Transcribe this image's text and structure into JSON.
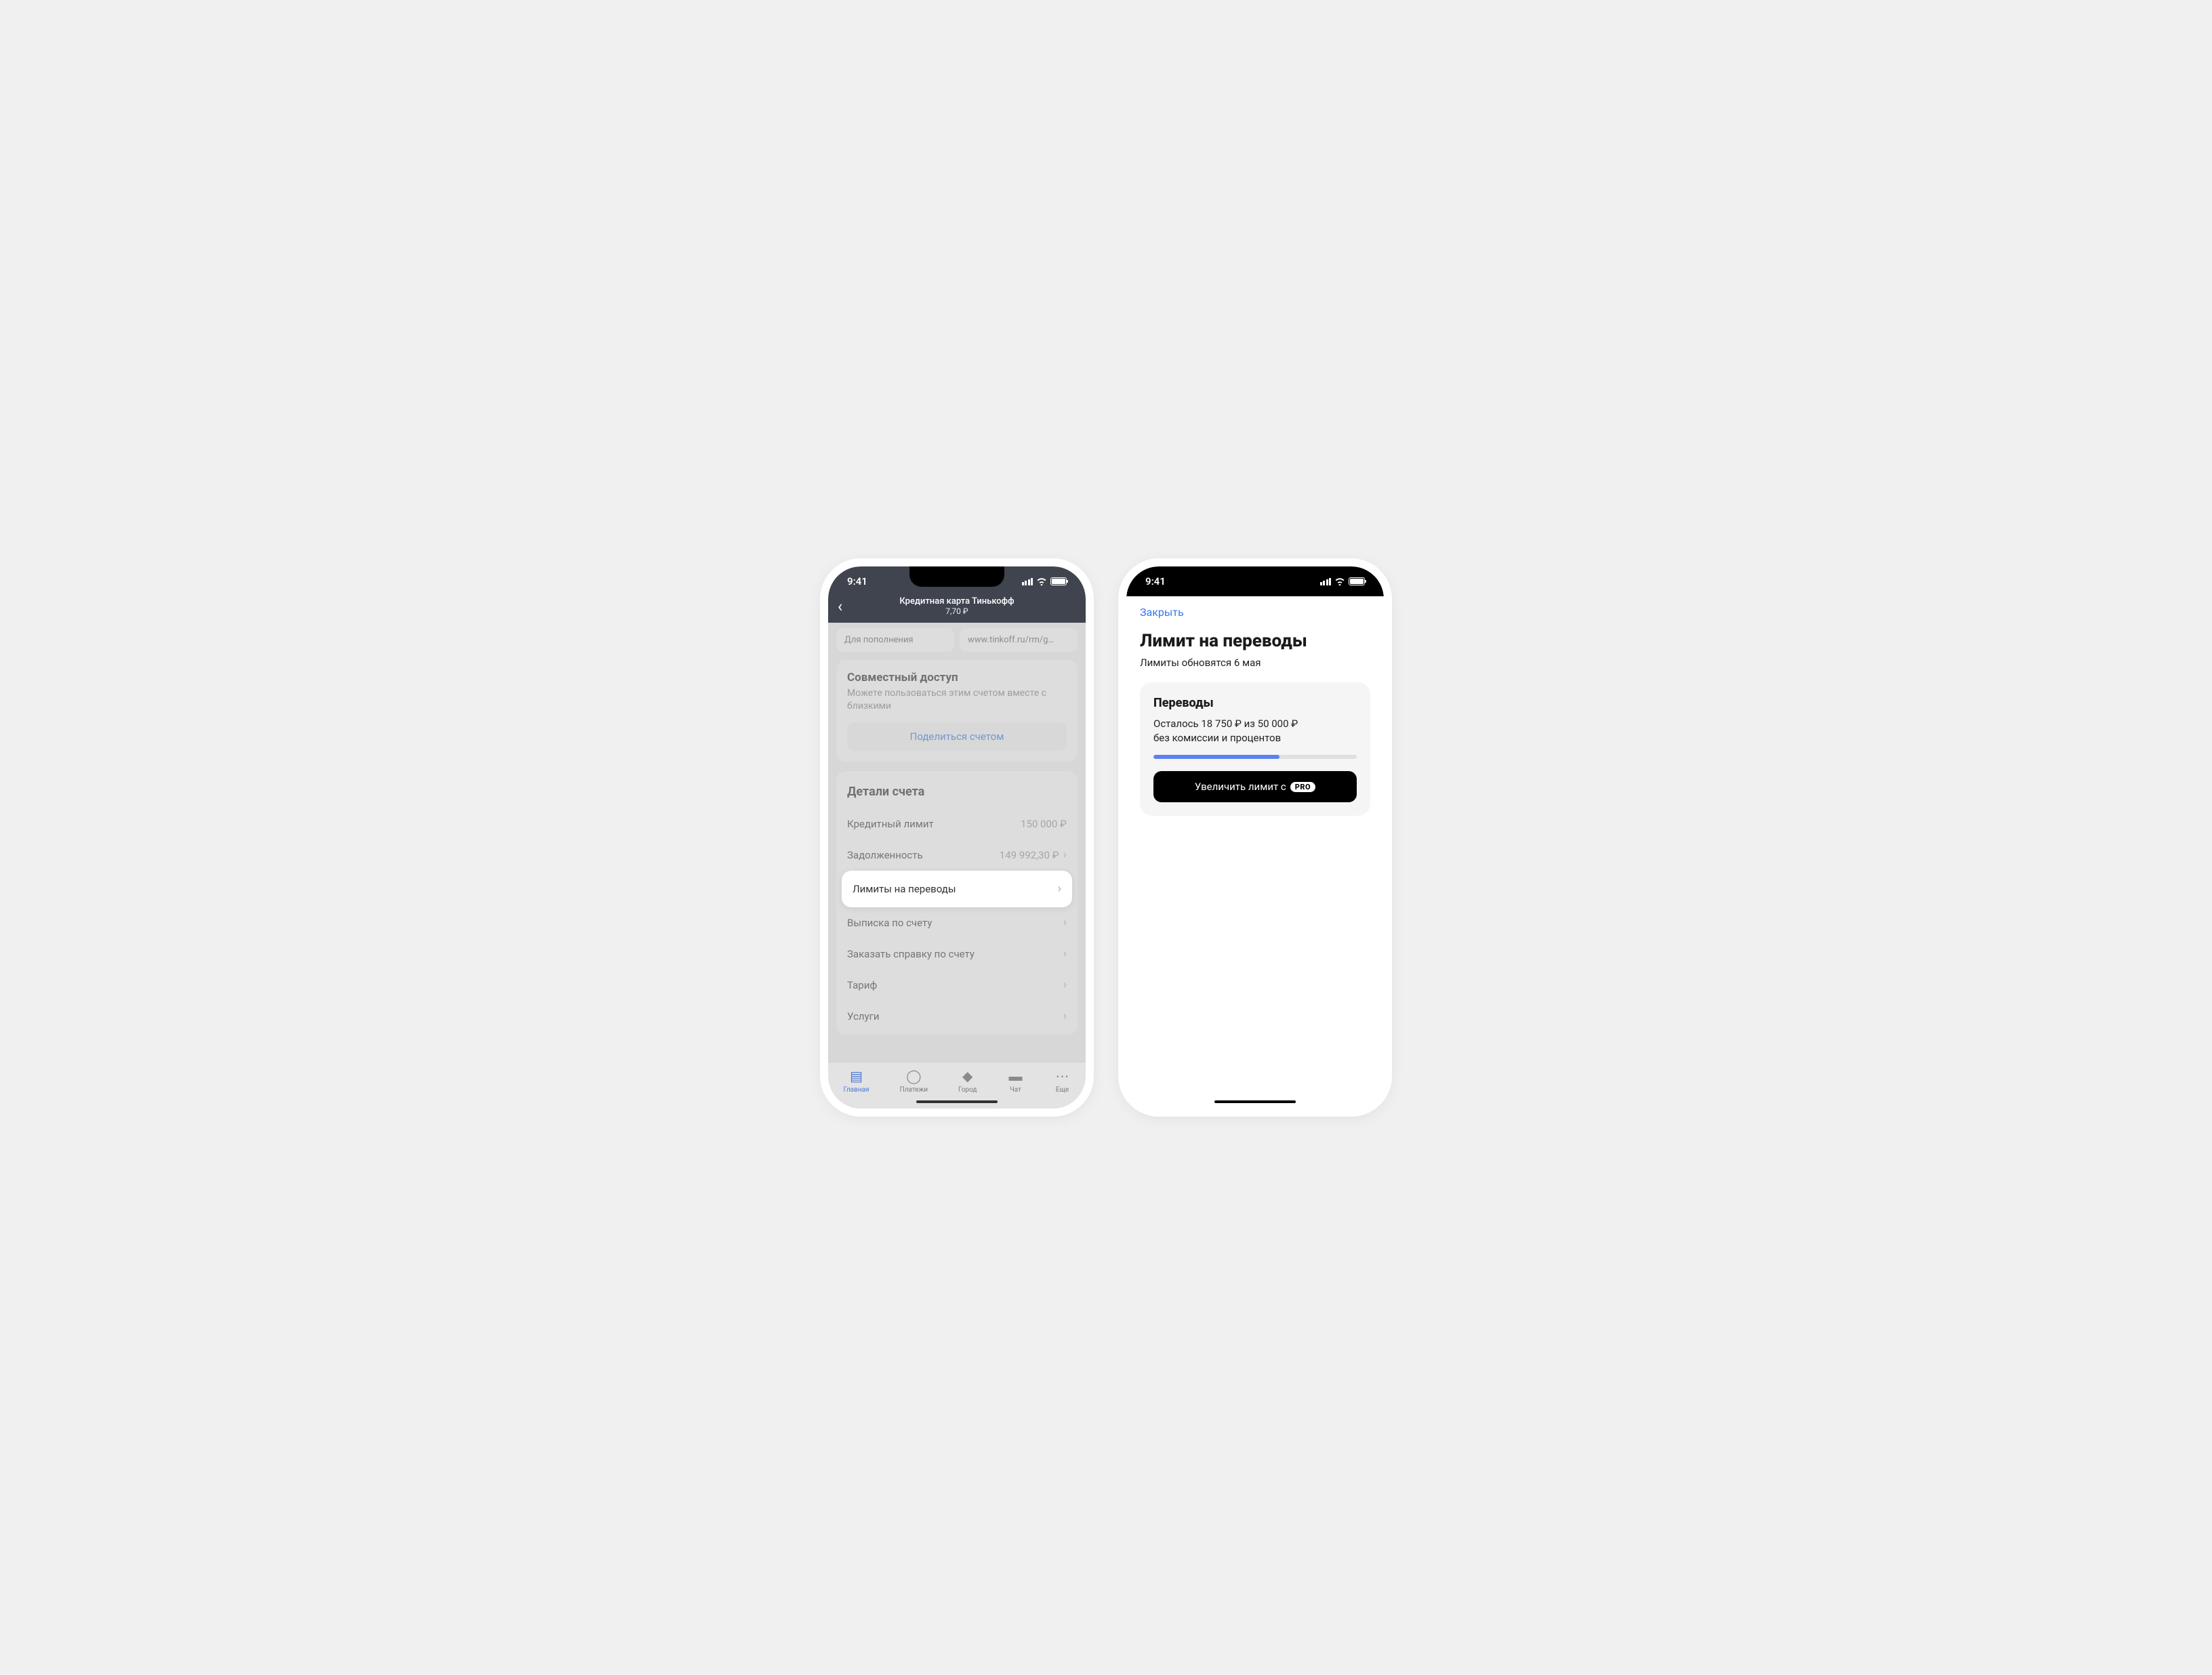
{
  "status": {
    "time": "9:41"
  },
  "phone1": {
    "header": {
      "title": "Кредитная карта Тинькофф",
      "balance": "7,70 ₽"
    },
    "chips": {
      "deposit": "Для пополнения",
      "link": "www.tinkoff.ru/rm/g…"
    },
    "share": {
      "title": "Совместный доступ",
      "subtitle": "Можете пользоваться этим счетом вместе с близкими",
      "button": "Поделиться счетом"
    },
    "details": {
      "title": "Детали счета",
      "rows": [
        {
          "label": "Кредитный лимит",
          "value": "150 000 ₽",
          "chevron": false
        },
        {
          "label": "Задолженность",
          "value": "149 992,30 ₽",
          "chevron": true
        },
        {
          "label": "Лимиты на переводы",
          "value": "",
          "chevron": true,
          "highlight": true
        },
        {
          "label": "Выписка по счету",
          "value": "",
          "chevron": true
        },
        {
          "label": "Заказать справку по счету",
          "value": "",
          "chevron": true
        },
        {
          "label": "Тариф",
          "value": "",
          "chevron": true
        },
        {
          "label": "Услуги",
          "value": "",
          "chevron": true
        }
      ]
    },
    "tabs": [
      {
        "label": "Главная"
      },
      {
        "label": "Платежи"
      },
      {
        "label": "Город"
      },
      {
        "label": "Чат"
      },
      {
        "label": "Еще"
      }
    ]
  },
  "phone2": {
    "close": "Закрыть",
    "title": "Лимит на переводы",
    "subtitle": "Лимиты обновятся 6 мая",
    "card": {
      "title": "Переводы",
      "line1": "Осталось 18 750 ₽ из 50 000 ₽",
      "line2": "без комиссии и процентов",
      "progress_percent": 62,
      "button": "Увеличить лимит с",
      "badge": "PRO"
    }
  }
}
